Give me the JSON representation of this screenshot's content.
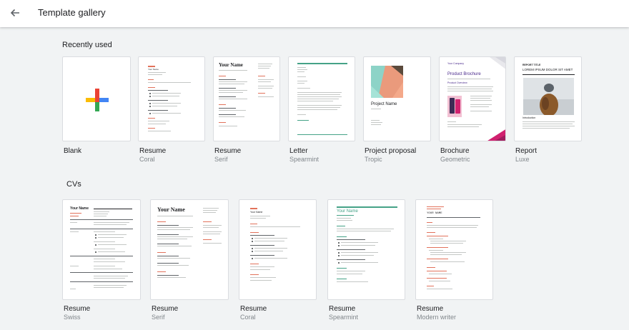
{
  "header": {
    "title": "Template gallery"
  },
  "sections": {
    "recent": {
      "title": "Recently used",
      "items": [
        {
          "name": "Blank",
          "subtitle": ""
        },
        {
          "name": "Resume",
          "subtitle": "Coral"
        },
        {
          "name": "Resume",
          "subtitle": "Serif"
        },
        {
          "name": "Letter",
          "subtitle": "Spearmint"
        },
        {
          "name": "Project proposal",
          "subtitle": "Tropic"
        },
        {
          "name": "Brochure",
          "subtitle": "Geometric"
        },
        {
          "name": "Report",
          "subtitle": "Luxe"
        }
      ]
    },
    "cvs": {
      "title": "CVs",
      "items": [
        {
          "name": "Resume",
          "subtitle": "Swiss"
        },
        {
          "name": "Resume",
          "subtitle": "Serif"
        },
        {
          "name": "Resume",
          "subtitle": "Coral"
        },
        {
          "name": "Resume",
          "subtitle": "Spearmint"
        },
        {
          "name": "Resume",
          "subtitle": "Modern writer"
        }
      ]
    }
  },
  "thumbs": {
    "your_name": "Your Name",
    "your_name_caps": "YOUR NAME",
    "project_name": "Project Name",
    "your_company": "Your Company",
    "product_brochure": "Product Brochure",
    "product_overview": "Product Overview",
    "report_title": "REPORT TITLE",
    "report_subtitle": "LOREM IPSUM DOLOR SIT AMET",
    "introduction": "Introduction"
  },
  "colors": {
    "coral": "#e2725b",
    "spearmint": "#45a287",
    "brochure_purple": "#4a2a8c",
    "brochure_pink": "#d0216f",
    "plus_red": "#ea4335",
    "plus_blue": "#4285f4",
    "plus_green": "#34a853",
    "plus_yellow": "#fbbc04"
  },
  "icons": {
    "back": "arrow-left-icon",
    "blank": "plus-icon"
  }
}
